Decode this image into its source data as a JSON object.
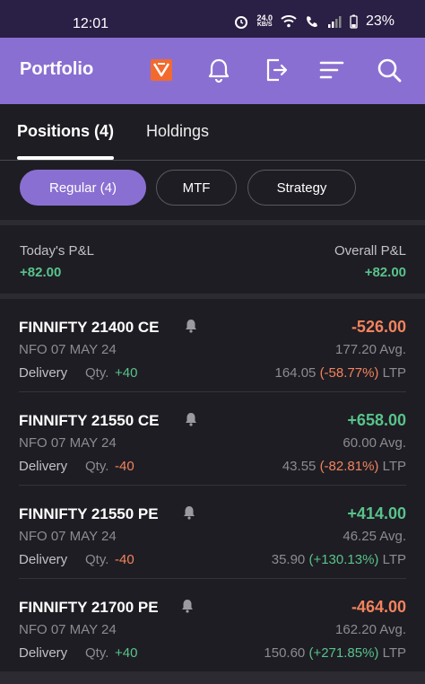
{
  "status": {
    "time": "12:01",
    "speed_top": "24.0",
    "speed_unit": "KB/S",
    "battery": "23%"
  },
  "app": {
    "title": "Portfolio"
  },
  "tabs": [
    {
      "label": "Positions (4)"
    },
    {
      "label": "Holdings"
    }
  ],
  "chips": [
    {
      "label": "Regular (4)"
    },
    {
      "label": "MTF"
    },
    {
      "label": "Strategy"
    }
  ],
  "summary": {
    "today_label": "Today's P&L",
    "today_value": "+82.00",
    "overall_label": "Overall P&L",
    "overall_value": "+82.00"
  },
  "positions": [
    {
      "symbol": "FINNIFTY 21400 CE",
      "pnl": "-526.00",
      "exchange": "NFO 07 MAY 24",
      "avg": "177.20 Avg.",
      "product": "Delivery",
      "qty_label": "Qty.",
      "qty": "+40",
      "ltp_price": "164.05",
      "ltp_change": "(-58.77%)",
      "ltp_suffix": "LTP"
    },
    {
      "symbol": "FINNIFTY 21550 CE",
      "pnl": "+658.00",
      "exchange": "NFO 07 MAY 24",
      "avg": "60.00 Avg.",
      "product": "Delivery",
      "qty_label": "Qty.",
      "qty": "-40",
      "ltp_price": "43.55",
      "ltp_change": "(-82.81%)",
      "ltp_suffix": "LTP"
    },
    {
      "symbol": "FINNIFTY 21550 PE",
      "pnl": "+414.00",
      "exchange": "NFO 07 MAY 24",
      "avg": "46.25 Avg.",
      "product": "Delivery",
      "qty_label": "Qty.",
      "qty": "-40",
      "ltp_price": "35.90",
      "ltp_change": "(+130.13%)",
      "ltp_suffix": "LTP"
    },
    {
      "symbol": "FINNIFTY 21700 PE",
      "pnl": "-464.00",
      "exchange": "NFO 07 MAY 24",
      "avg": "162.20 Avg.",
      "product": "Delivery",
      "qty_label": "Qty.",
      "qty": "+40",
      "ltp_price": "150.60",
      "ltp_change": "(+271.85%)",
      "ltp_suffix": "LTP"
    }
  ],
  "colors": {
    "accent": "#8a6fd2",
    "positive": "#58c38b",
    "negative": "#f3835e"
  }
}
